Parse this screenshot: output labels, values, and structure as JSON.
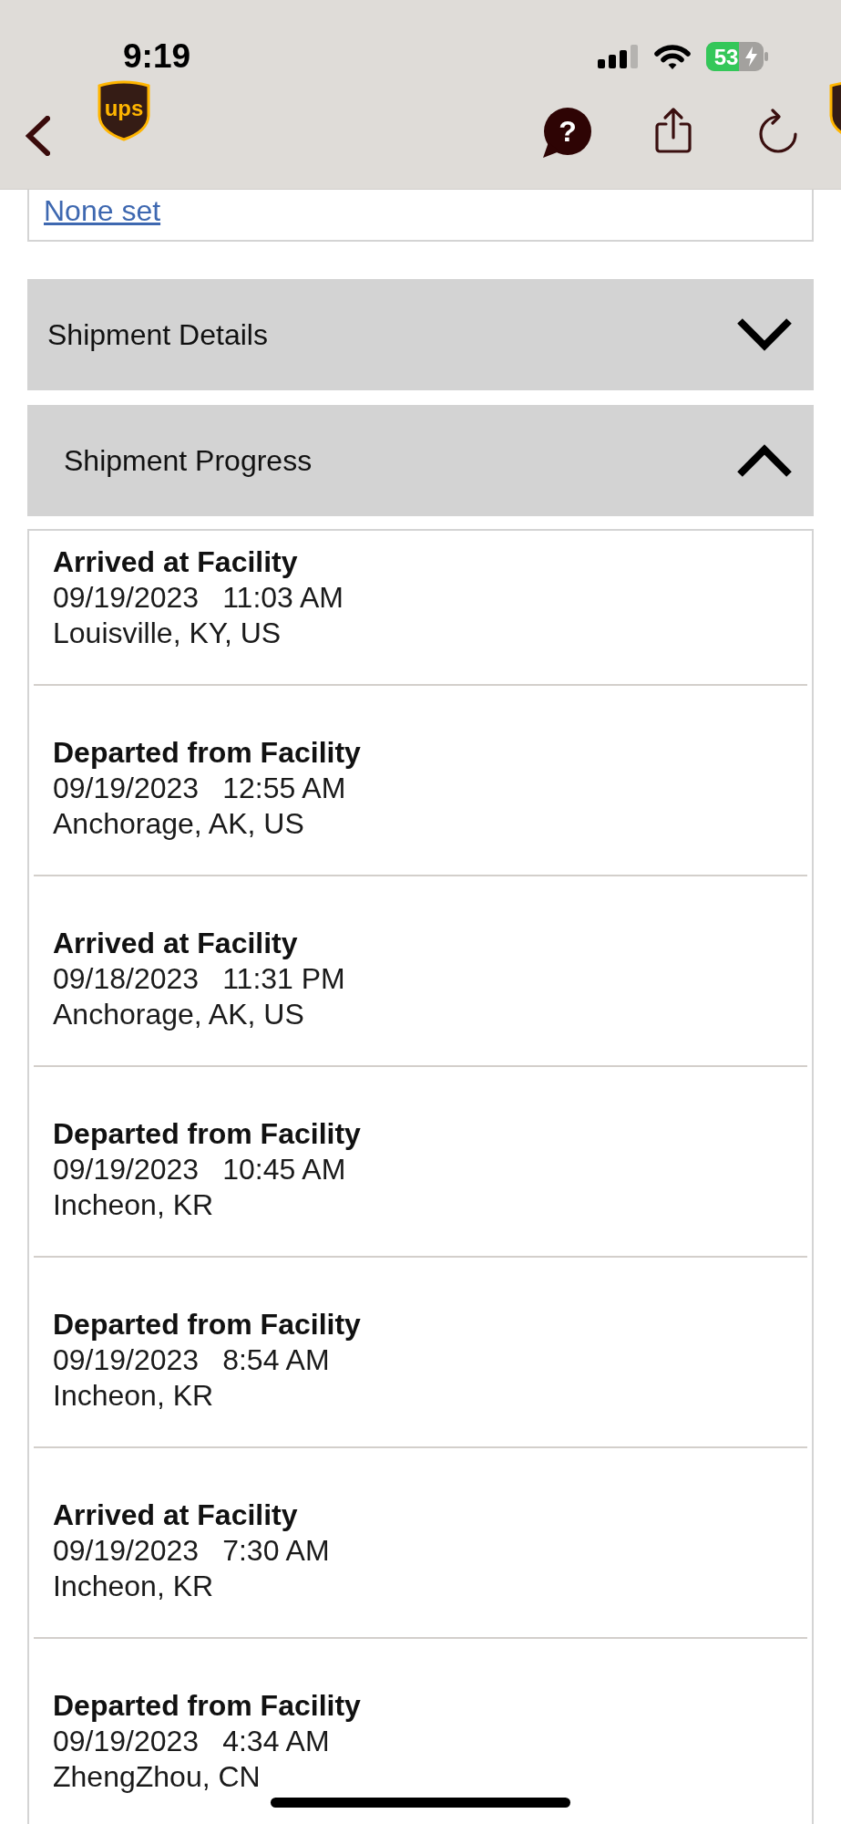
{
  "status_bar": {
    "time": "9:19",
    "battery": "53"
  },
  "nav_bar": {
    "logo_text": "ups",
    "help_glyph": "?"
  },
  "info_card": {
    "link": "None set"
  },
  "sections": [
    {
      "title": "Shipment Details",
      "expanded": false
    },
    {
      "title": "Shipment Progress",
      "expanded": true,
      "events": [
        {
          "status": "Arrived at Facility",
          "date": "09/19/2023",
          "time": "11:03 AM",
          "location": "Louisville, KY, US"
        },
        {
          "status": "Departed from Facility",
          "date": "09/19/2023",
          "time": "12:55 AM",
          "location": "Anchorage, AK, US"
        },
        {
          "status": "Arrived at Facility",
          "date": "09/18/2023",
          "time": "11:31 PM",
          "location": "Anchorage, AK, US"
        },
        {
          "status": "Departed from Facility",
          "date": "09/19/2023",
          "time": "10:45 AM",
          "location": "Incheon, KR"
        },
        {
          "status": "Departed from Facility",
          "date": "09/19/2023",
          "time": "8:54 AM",
          "location": "Incheon, KR"
        },
        {
          "status": "Arrived at Facility",
          "date": "09/19/2023",
          "time": "7:30 AM",
          "location": "Incheon, KR"
        },
        {
          "status": "Departed from Facility",
          "date": "09/19/2023",
          "time": "4:34 AM",
          "location": "ZhengZhou, CN"
        }
      ]
    }
  ]
}
